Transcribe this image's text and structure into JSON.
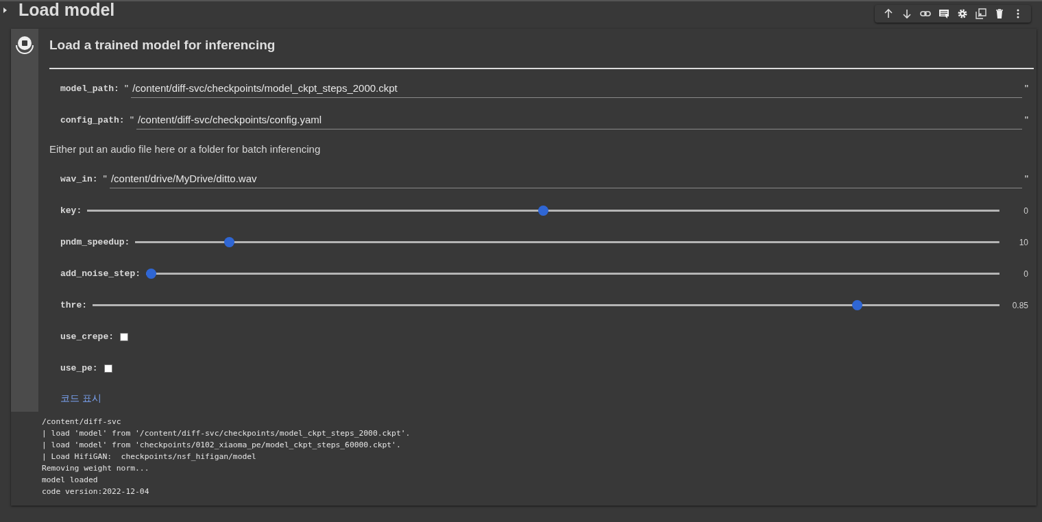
{
  "section": {
    "title": "Load model"
  },
  "form": {
    "title": "Load a trained model for inferencing",
    "params": [
      {
        "kind": "text",
        "label": "model_path:",
        "open_quote": "\"",
        "value": "/content/diff-svc/checkpoints/model_ckpt_steps_2000.ckpt",
        "close_quote": "\""
      },
      {
        "kind": "text",
        "label": "config_path:",
        "open_quote": "\"",
        "value": "/content/diff-svc/checkpoints/config.yaml",
        "close_quote": "\""
      },
      {
        "kind": "note",
        "text": "Either put an audio file here or a folder for batch inferencing"
      },
      {
        "kind": "text",
        "label": "wav_in:",
        "open_quote": "\"",
        "value": "/content/drive/MyDrive/ditto.wav",
        "close_quote": "\""
      },
      {
        "kind": "slider",
        "label": "key:",
        "level": 0.5,
        "reading": "0"
      },
      {
        "kind": "slider",
        "label": "pndm_speedup:",
        "level": 0.104,
        "reading": "10"
      },
      {
        "kind": "slider",
        "label": "add_noise_step:",
        "level": 0,
        "reading": "0"
      },
      {
        "kind": "slider",
        "label": "thre:",
        "level": 0.847,
        "reading": "0.85"
      },
      {
        "kind": "checkbox",
        "label": "use_crepe:",
        "checked": false
      },
      {
        "kind": "checkbox",
        "label": "use_pe:",
        "checked": false
      }
    ],
    "show_code_link": "코드 표시"
  },
  "output": [
    "/content/diff-svc",
    "| load 'model' from '/content/diff-svc/checkpoints/model_ckpt_steps_2000.ckpt'.",
    "| load 'model' from 'checkpoints/0102_xiaoma_pe/model_ckpt_steps_60000.ckpt'.",
    "| Load HifiGAN:  checkpoints/nsf_hifigan/model",
    "Removing weight norm...",
    "model loaded",
    "code version:2022-12-04"
  ]
}
